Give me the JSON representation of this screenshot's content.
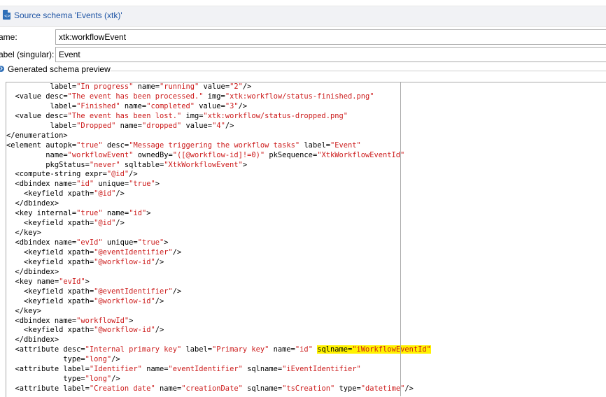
{
  "window": {
    "title": "Source schema 'Events (xtk)'",
    "icon": "xml-document-icon"
  },
  "fields": {
    "name_label": "ame:",
    "name_value": "xtk:workflowEvent",
    "label_label": "abel (singular):",
    "label_value": "Event"
  },
  "preview": {
    "label": "Generated schema preview"
  },
  "colors": {
    "title_text": "#1f55a5",
    "string_literal": "#cc1b1b",
    "highlight": "#fff200",
    "accent_icon": "#2f6fb8"
  },
  "code_lines": [
    "          label=\"In progress\" name=\"running\" value=\"2\"/>",
    "  <value desc=\"The event has been processed.\" img=\"xtk:workflow/status-finished.png\"",
    "          label=\"Finished\" name=\"completed\" value=\"3\"/>",
    "  <value desc=\"The event has been lost.\" img=\"xtk:workflow/status-dropped.png\"",
    "          label=\"Dropped\" name=\"dropped\" value=\"4\"/>",
    "</enumeration>",
    "<element autopk=\"true\" desc=\"Message triggering the workflow tasks\" label=\"Event\"",
    "         name=\"workflowEvent\" ownedBy=\"([@workflow-id]!=0)\" pkSequence=\"XtkWorkflowEventId\"",
    "         pkgStatus=\"never\" sqltable=\"XtkWorkflowEvent\">",
    "  <compute-string expr=\"@id\"/>",
    "  <dbindex name=\"id\" unique=\"true\">",
    "    <keyfield xpath=\"@id\"/>",
    "  </dbindex>",
    "  <key internal=\"true\" name=\"id\">",
    "    <keyfield xpath=\"@id\"/>",
    "  </key>",
    "  <dbindex name=\"evId\" unique=\"true\">",
    "    <keyfield xpath=\"@eventIdentifier\"/>",
    "    <keyfield xpath=\"@workflow-id\"/>",
    "  </dbindex>",
    "  <key name=\"evId\">",
    "    <keyfield xpath=\"@eventIdentifier\"/>",
    "    <keyfield xpath=\"@workflow-id\"/>",
    "  </key>",
    "  <dbindex name=\"workflowId\">",
    "    <keyfield xpath=\"@workflow-id\"/>",
    "  </dbindex>",
    "  <attribute desc=\"Internal primary key\" label=\"Primary key\" name=\"id\" sqlname=\"iWorkflowEventId\"",
    "             type=\"long\"/>",
    "  <attribute label=\"Identifier\" name=\"eventIdentifier\" sqlname=\"iEventIdentifier\"",
    "             type=\"long\"/>",
    "  <attribute label=\"Creation date\" name=\"creationDate\" sqlname=\"tsCreation\" type=\"datetime\"/>"
  ],
  "highlighted_text": "sqlname=\"iWorkflowEventId\""
}
